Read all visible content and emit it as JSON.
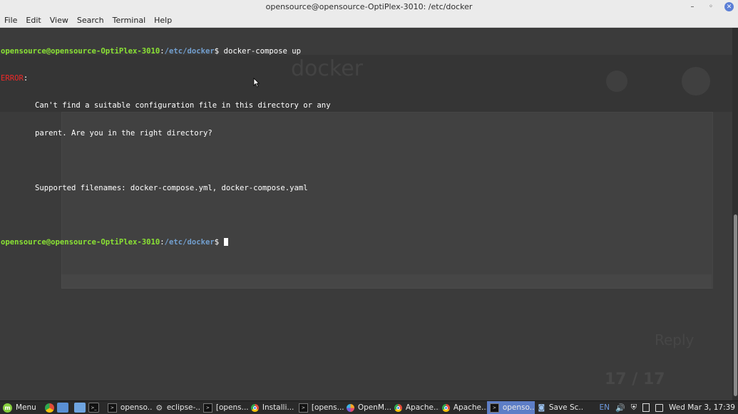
{
  "window": {
    "title": "opensource@opensource-OptiPlex-3010: /etc/docker",
    "controls": {
      "minimize": "–",
      "maximize": "◦",
      "close": "✕"
    }
  },
  "menu": [
    "File",
    "Edit",
    "View",
    "Search",
    "Terminal",
    "Help"
  ],
  "terminal": {
    "prompt_user": "opensource@opensource-OptiPlex-3010",
    "prompt_sep": ":",
    "prompt_path": "/etc/docker",
    "prompt_symbol": "$ ",
    "command": "docker-compose up",
    "error_label": "ERROR",
    "error_colon": ":",
    "message_line1": "Can't find a suitable configuration file in this directory or any",
    "message_line2": "parent. Are you in the right directory?",
    "message_line3": "Supported filenames: docker-compose.yml, docker-compose.yaml"
  },
  "background_ghost": {
    "docker_text": "docker",
    "reply_text": "Reply",
    "post_count": "17 / 17"
  },
  "taskbar": {
    "menu_label": "Menu",
    "windows": [
      {
        "label": "openso...",
        "icon": "terminal-icon",
        "active": false
      },
      {
        "label": "eclipse-...",
        "icon": "eclipse-icon",
        "active": false
      },
      {
        "label": "[opens...",
        "icon": "terminal-icon",
        "active": false
      },
      {
        "label": "Installi...",
        "icon": "chrome-icon",
        "active": false
      },
      {
        "label": "[opens...",
        "icon": "terminal-icon",
        "active": false
      },
      {
        "label": "OpenM...",
        "icon": "openmrs-icon",
        "active": false
      },
      {
        "label": "Apache...",
        "icon": "chrome-icon",
        "active": false
      },
      {
        "label": "Apache...",
        "icon": "chrome-icon",
        "active": false
      },
      {
        "label": "openso...",
        "icon": "terminal-icon",
        "active": true
      },
      {
        "label": "Save Sc...",
        "icon": "screenshot-icon",
        "active": false
      }
    ],
    "language": "EN",
    "clock": "Wed Mar 3, 17:39"
  },
  "colors": {
    "prompt_user": "#8ae234",
    "prompt_path": "#729fcf",
    "error": "#ef2929",
    "active_task": "#5d7ec7"
  }
}
